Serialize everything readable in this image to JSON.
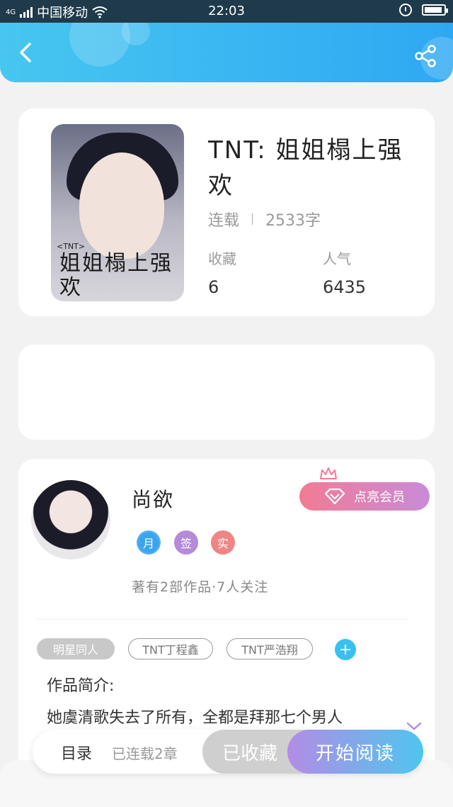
{
  "status_bar": {
    "network": "4G",
    "carrier": "中国移动",
    "time": "22:03"
  },
  "book": {
    "title": "TNT:  姐姐榻上强欢",
    "status": "连载",
    "word_count": "2533字",
    "favorites_label": "收藏",
    "favorites_value": "6",
    "popularity_label": "人气",
    "popularity_value": "6435",
    "cover": {
      "tag": "<TNT>",
      "title": "姐姐榻上强欢"
    }
  },
  "author": {
    "name": "尚欲",
    "vip_button": "点亮会员",
    "badges": [
      "月",
      "签",
      "实"
    ],
    "stats": "著有2部作品·7人关注"
  },
  "tags": [
    "明星同人",
    "TNT丁程鑫",
    "TNT严浩翔"
  ],
  "intro": {
    "label": "作品简介:",
    "text": "她虞清歌失去了所有，全都是拜那七个男人"
  },
  "bottom_bar": {
    "toc_label": "目录",
    "chapters": "已连载2章",
    "favorite_button": "已收藏",
    "read_button": "开始阅读"
  },
  "colors": {
    "header_start": "#47c6f0",
    "header_end": "#2ea8f3",
    "vip_start": "#f27b93",
    "vip_end": "#c98bd9",
    "read_start": "#b38ce6",
    "read_end": "#4ec6ee"
  }
}
